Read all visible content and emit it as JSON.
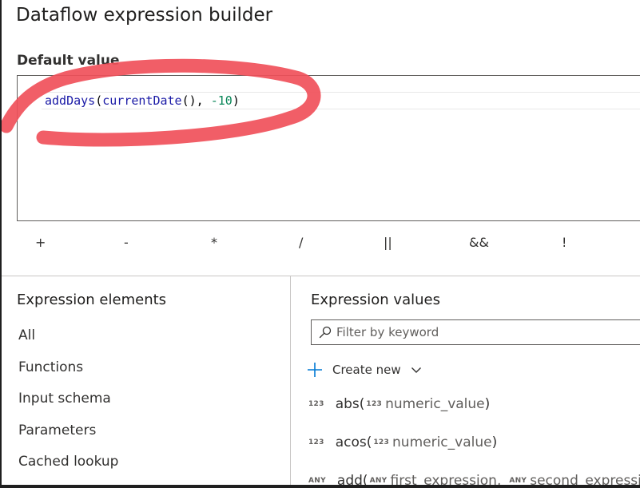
{
  "dialog": {
    "title": "Dataflow expression builder",
    "field_label": "Default value"
  },
  "editor": {
    "code_parts": [
      "addDays",
      "(",
      "currentDate",
      "(), ",
      "-10",
      ")"
    ],
    "full_expression": "addDays(currentDate(), -10)"
  },
  "annotation": {
    "color": "#f0505a"
  },
  "operators": [
    "+",
    "-",
    "*",
    "/",
    "||",
    "&&",
    "!"
  ],
  "expression_elements": {
    "title": "Expression elements",
    "items": [
      "All",
      "Functions",
      "Input schema",
      "Parameters",
      "Cached lookup"
    ]
  },
  "expression_values": {
    "title": "Expression values",
    "filter_placeholder": "Filter by keyword",
    "create_new_label": "Create new",
    "functions": [
      {
        "type": "123",
        "name": "abs(",
        "params": [
          {
            "type": "123",
            "name": "numeric_value"
          }
        ],
        "close": ")"
      },
      {
        "type": "123",
        "name": "acos(",
        "params": [
          {
            "type": "123",
            "name": "numeric_value"
          }
        ],
        "close": ")"
      },
      {
        "type": "ANY",
        "name": "add(",
        "params": [
          {
            "type": "ANY",
            "name": "first_expression,"
          },
          {
            "type": "ANY",
            "name": "second_expression"
          }
        ],
        "close": ")"
      }
    ]
  },
  "colors": {
    "function_name": "#1a1aa6",
    "number": "#098658",
    "accent": "#0078d4",
    "text": "#323130"
  }
}
